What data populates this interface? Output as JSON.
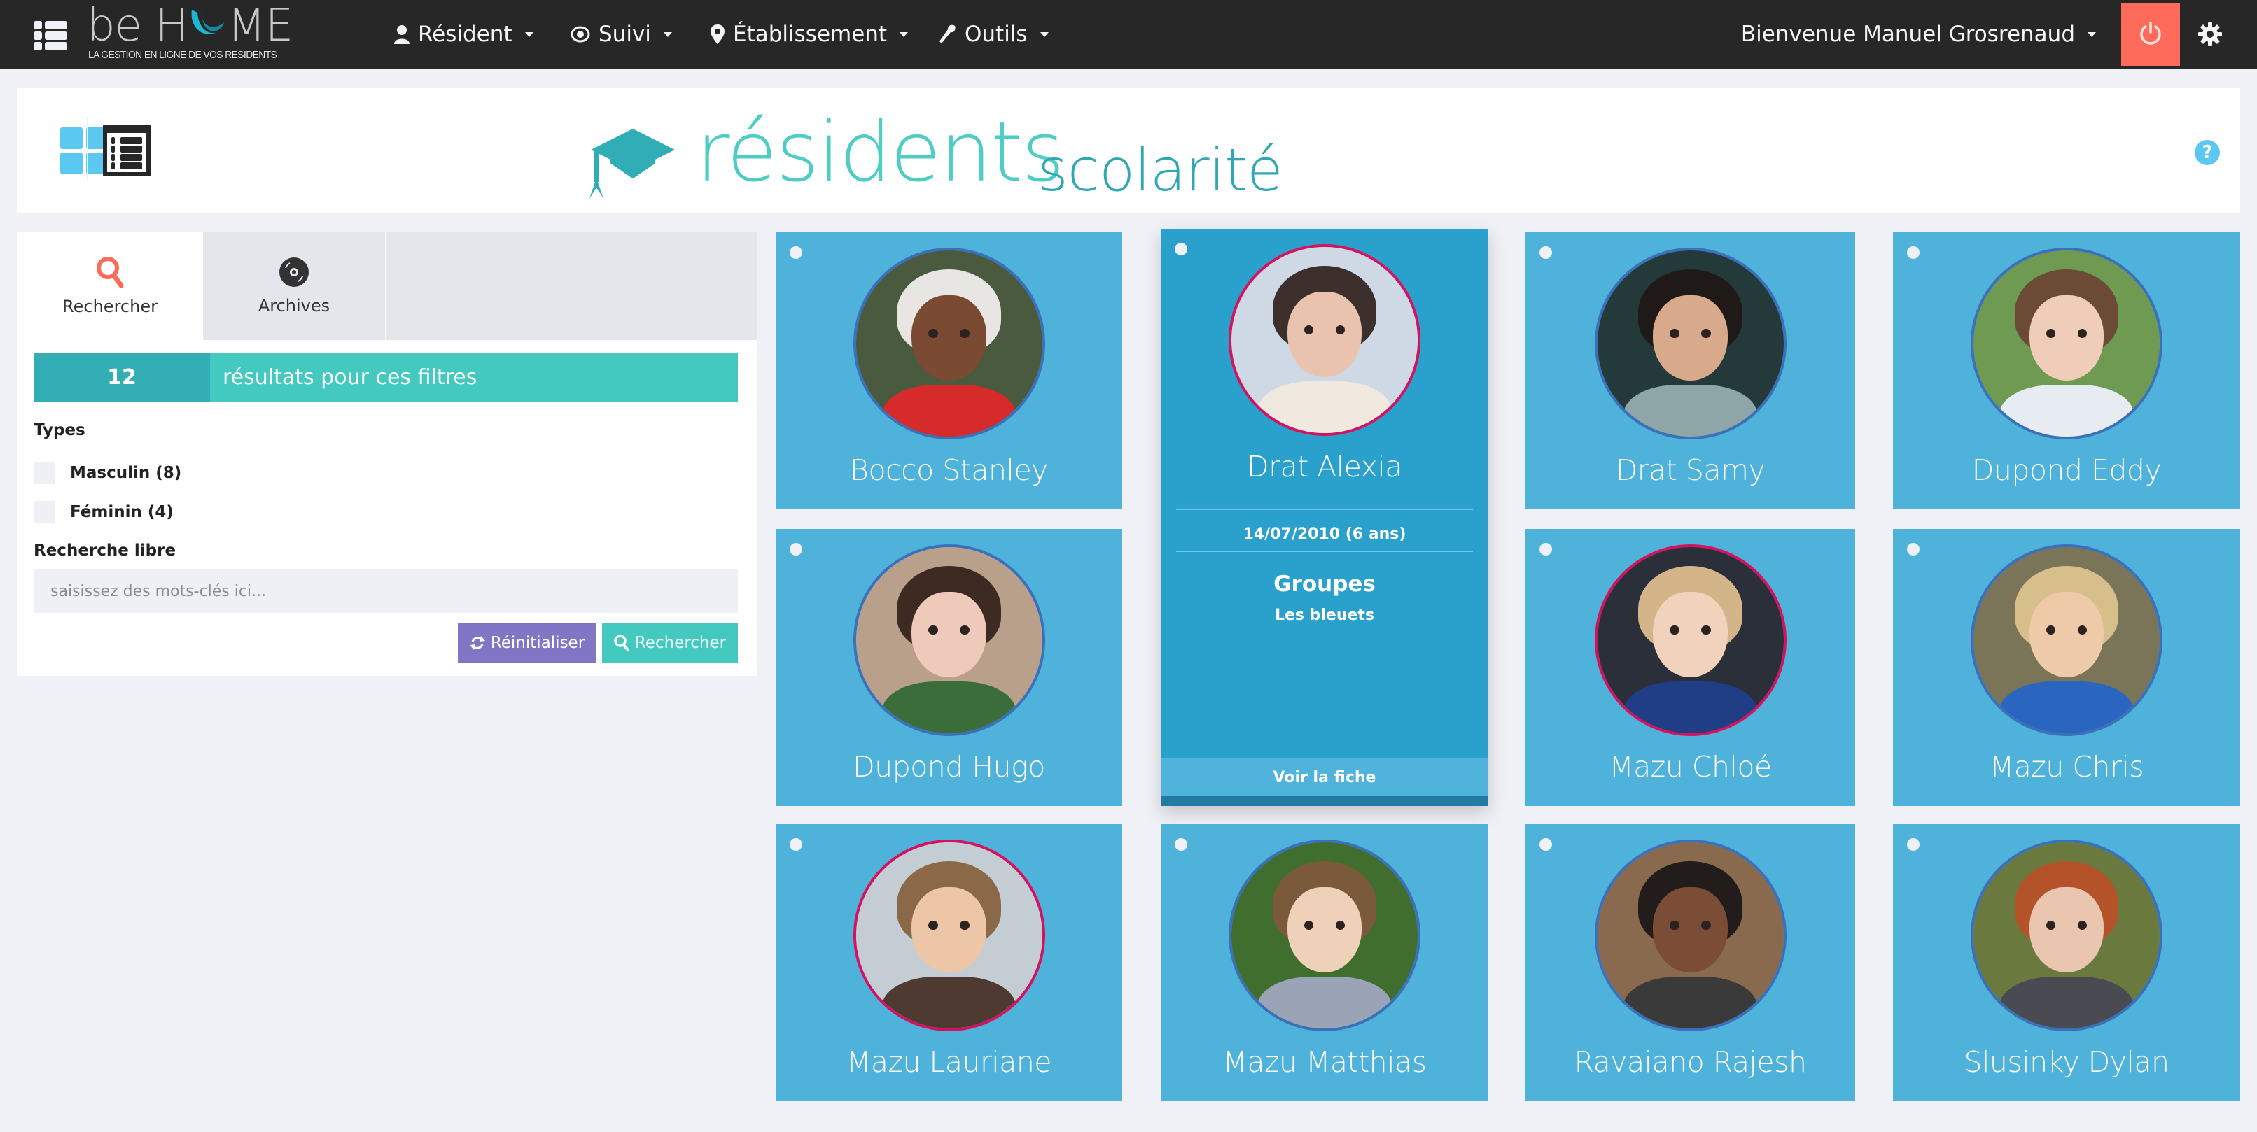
{
  "app": {
    "logo_main": "be H",
    "logo_main_end": "ME",
    "logo_tagline": "LA GESTION EN LIGNE DE VOS RESIDENTS"
  },
  "nav": {
    "items": [
      {
        "label": "Résident",
        "icon": "user-icon"
      },
      {
        "label": "Suivi",
        "icon": "eye-icon"
      },
      {
        "label": "Établissement",
        "icon": "map-marker-icon"
      },
      {
        "label": "Outils",
        "icon": "wrench-icon"
      }
    ],
    "welcome": "Bienvenue Manuel Grosrenaud",
    "power_icon": "power-icon",
    "settings_icon": "gear-icon"
  },
  "header": {
    "title_main": "résidents",
    "title_sub": "scolarité",
    "icon": "graduation-cap-icon",
    "help": "?"
  },
  "filters": {
    "tabs": [
      {
        "label": "Rechercher",
        "icon": "search-icon",
        "active": true
      },
      {
        "label": "Archives",
        "icon": "archive-disc-icon",
        "active": false
      }
    ],
    "results_count": "12",
    "results_text": "résultats pour ces filtres",
    "types_label": "Types",
    "types": [
      {
        "label": "Masculin (8)",
        "checked": false
      },
      {
        "label": "Féminin (4)",
        "checked": false
      }
    ],
    "free_search_label": "Recherche libre",
    "free_search_placeholder": "saisissez des mots-clés ici...",
    "free_search_value": "",
    "reset_label": "Réinitialiser",
    "search_label": "Rechercher"
  },
  "residents": [
    {
      "name": "Bocco Stanley",
      "gender": "m"
    },
    {
      "name": "Drat Alexia",
      "gender": "f",
      "expanded": true,
      "dob": "14/07/2010 (6 ans)",
      "groups_label": "Groupes",
      "group": "Les bleuets",
      "view_label": "Voir la fiche"
    },
    {
      "name": "Drat Samy",
      "gender": "m"
    },
    {
      "name": "Dupond Eddy",
      "gender": "m"
    },
    {
      "name": "Dupond Hugo",
      "gender": "m"
    },
    {
      "name": "Mazu Chloé",
      "gender": "f"
    },
    {
      "name": "Mazu Chris",
      "gender": "m"
    },
    {
      "name": "Mazu Lauriane",
      "gender": "f"
    },
    {
      "name": "Mazu Matthias",
      "gender": "m"
    },
    {
      "name": "Ravaiano Rajesh",
      "gender": "m"
    },
    {
      "name": "Slusinky Dylan",
      "gender": "m"
    }
  ],
  "colors": {
    "navbar": "#272727",
    "power": "#FE6B5B",
    "teal_light": "#4ECDC4",
    "teal_dark": "#2FA8B4",
    "card": "#4FB2DA",
    "card_expanded": "#2AA0CD",
    "border_male": "#3B70BB",
    "border_female": "#D6125F",
    "reset_button": "#8176C5",
    "search_button": "#43C9C0"
  }
}
